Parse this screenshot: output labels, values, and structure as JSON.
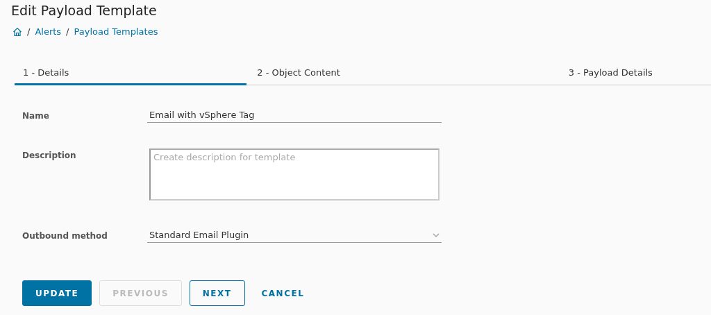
{
  "title": "Edit Payload Template",
  "breadcrumb": [
    {
      "separator": "/",
      "label": "Alerts"
    },
    {
      "separator": "/",
      "label": "Payload Templates"
    }
  ],
  "tabs": [
    {
      "label": "1 - Details",
      "selected": true
    },
    {
      "label": "2 - Object Content",
      "selected": false
    },
    {
      "label": "3 - Payload Details",
      "selected": false
    }
  ],
  "form": {
    "name": {
      "label": "Name",
      "value": "Email with vSphere Tag"
    },
    "description": {
      "label": "Description",
      "placeholder": "Create description for template"
    },
    "outbound_method": {
      "label": "Outbound method",
      "value": "Standard Email Plugin"
    }
  },
  "buttons": [
    {
      "label": "UPDATE",
      "kind": "primary",
      "disabled": false
    },
    {
      "label": "PREVIOUS",
      "kind": "outline",
      "disabled": true
    },
    {
      "label": "NEXT",
      "kind": "outline",
      "disabled": false
    },
    {
      "label": "CANCEL",
      "kind": "flat",
      "disabled": false
    }
  ]
}
